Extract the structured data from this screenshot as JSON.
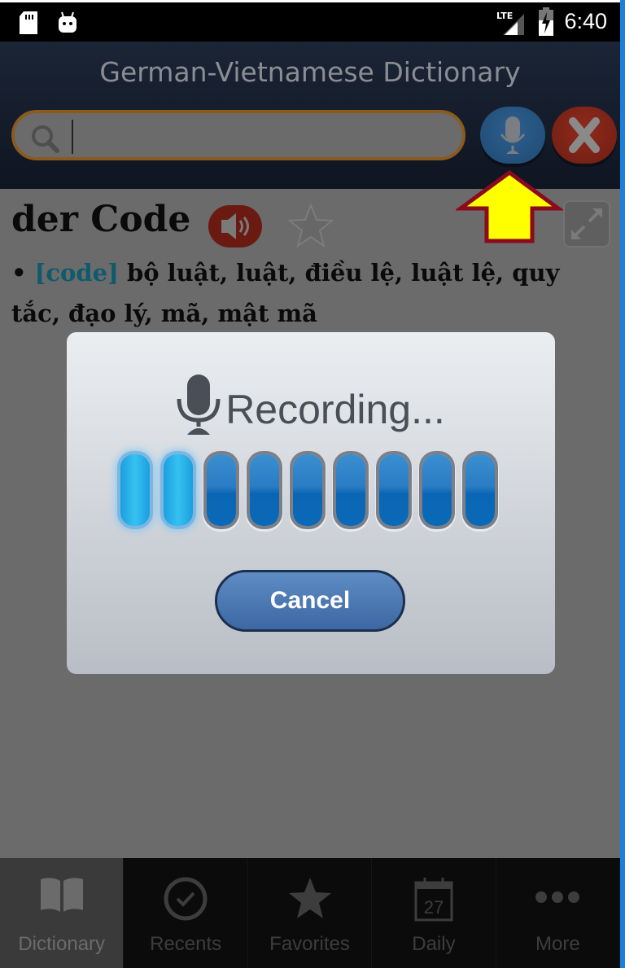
{
  "status_bar": {
    "time": "6:40",
    "network": "LTE",
    "icons": [
      "sd-card-icon",
      "android-icon",
      "lte-signal-icon",
      "battery-charging-icon"
    ]
  },
  "header": {
    "title": "German-Vietnamese Dictionary",
    "search": {
      "value": "",
      "placeholder": ""
    },
    "buttons": [
      "microphone-button",
      "clear-button"
    ]
  },
  "entry": {
    "headword": "der Code",
    "bullet": "•",
    "tag": "[code]",
    "definition": "bộ luật, luật, điều lệ, luật lệ, quy tắc, đạo lý, mã, mật mã"
  },
  "annotation": {
    "type": "arrow",
    "color": "#ffff00",
    "outline": "#8b0a1e",
    "points_to": "microphone-button"
  },
  "dialog": {
    "title": "Recording...",
    "level_bars_total": 9,
    "level_bars_active": 2,
    "cancel_label": "Cancel"
  },
  "tabbar": {
    "active": "Dictionary",
    "tabs": [
      {
        "label": "Dictionary",
        "icon": "book-icon"
      },
      {
        "label": "Recents",
        "icon": "check-circle-icon"
      },
      {
        "label": "Favorites",
        "icon": "star-icon"
      },
      {
        "label": "Daily",
        "icon": "calendar-icon",
        "icon_text": "27"
      },
      {
        "label": "More",
        "icon": "more-icon"
      }
    ]
  }
}
